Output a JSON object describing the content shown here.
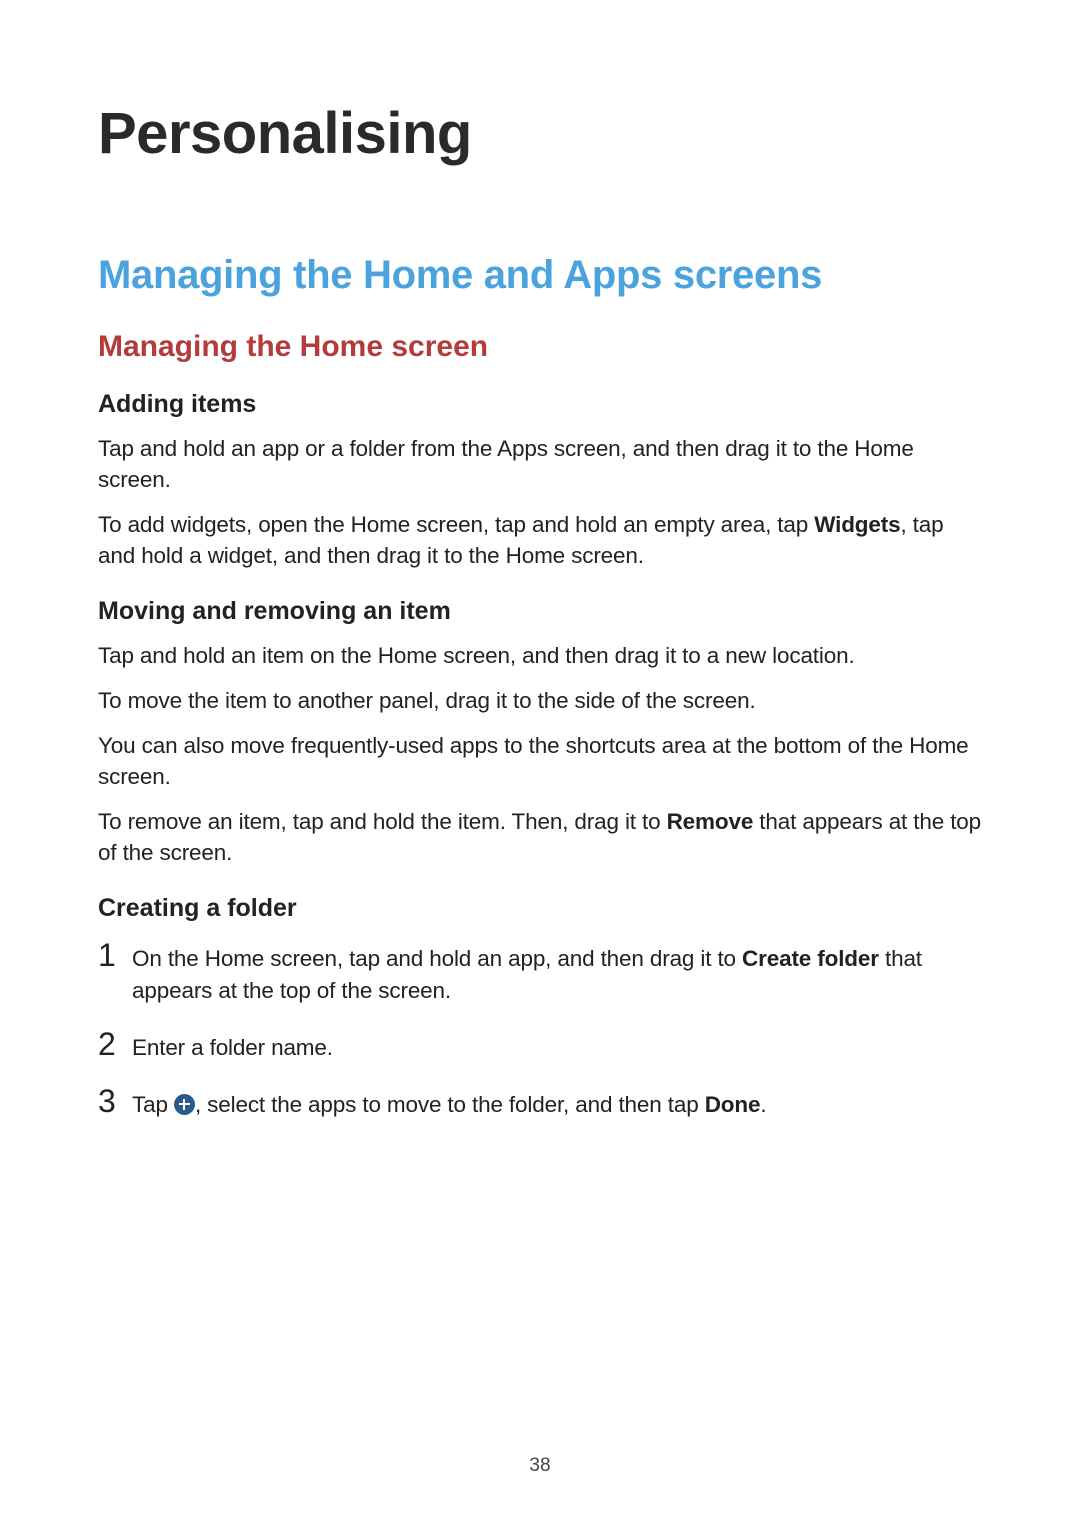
{
  "page_number": "38",
  "h1": "Personalising",
  "h2": "Managing the Home and Apps screens",
  "h3": "Managing the Home screen",
  "sections": {
    "adding_items": {
      "title": "Adding items",
      "p1": "Tap and hold an app or a folder from the Apps screen, and then drag it to the Home screen.",
      "p2_a": "To add widgets, open the Home screen, tap and hold an empty area, tap ",
      "p2_bold": "Widgets",
      "p2_b": ", tap and hold a widget, and then drag it to the Home screen."
    },
    "moving": {
      "title": "Moving and removing an item",
      "p1": "Tap and hold an item on the Home screen, and then drag it to a new location.",
      "p2": "To move the item to another panel, drag it to the side of the screen.",
      "p3": "You can also move frequently-used apps to the shortcuts area at the bottom of the Home screen.",
      "p4_a": "To remove an item, tap and hold the item. Then, drag it to ",
      "p4_bold": "Remove",
      "p4_b": " that appears at the top of the screen."
    },
    "folder": {
      "title": "Creating a folder",
      "step1_num": "1",
      "step1_a": "On the Home screen, tap and hold an app, and then drag it to ",
      "step1_bold": "Create folder",
      "step1_b": " that appears at the top of the screen.",
      "step2_num": "2",
      "step2": "Enter a folder name.",
      "step3_num": "3",
      "step3_a": "Tap ",
      "step3_b": ", select the apps to move to the folder, and then tap ",
      "step3_bold": "Done",
      "step3_c": "."
    }
  }
}
